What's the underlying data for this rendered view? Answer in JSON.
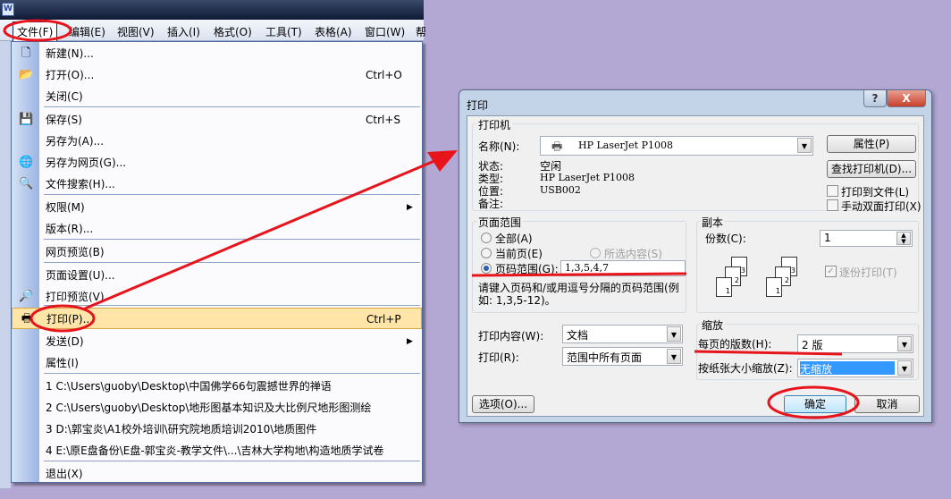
{
  "app": {
    "icon": "word-icon",
    "icon_text": "W"
  },
  "menubar": [
    {
      "label": "文件(F)"
    },
    {
      "label": "编辑(E)"
    },
    {
      "label": "视图(V)"
    },
    {
      "label": "插入(I)"
    },
    {
      "label": "格式(O)"
    },
    {
      "label": "工具(T)"
    },
    {
      "label": "表格(A)"
    },
    {
      "label": "窗口(W)"
    },
    {
      "label": "帮"
    }
  ],
  "file_menu": {
    "items": [
      {
        "label": "新建(N)...",
        "icon": "new-document-icon"
      },
      {
        "label": "打开(O)...",
        "shortcut": "Ctrl+O",
        "icon": "open-folder-icon"
      },
      {
        "label": "关闭(C)"
      },
      {
        "label": "保存(S)",
        "shortcut": "Ctrl+S",
        "icon": "save-icon"
      },
      {
        "label": "另存为(A)..."
      },
      {
        "label": "另存为网页(G)...",
        "icon": "web-page-icon"
      },
      {
        "label": "文件搜索(H)...",
        "icon": "file-search-icon"
      },
      {
        "label": "权限(M)",
        "submenu": true
      },
      {
        "label": "版本(R)..."
      },
      {
        "label": "网页预览(B)"
      },
      {
        "label": "页面设置(U)..."
      },
      {
        "label": "打印预览(V)",
        "icon": "print-preview-icon"
      },
      {
        "label": "打印(P)...",
        "shortcut": "Ctrl+P",
        "icon": "printer-icon",
        "highlighted": true
      },
      {
        "label": "发送(D)",
        "submenu": true
      },
      {
        "label": "属性(I)"
      },
      {
        "label": "1 C:\\Users\\guoby\\Desktop\\中国佛学66句震撼世界的禅语"
      },
      {
        "label": "2 C:\\Users\\guoby\\Desktop\\地形图基本知识及大比例尺地形图测绘"
      },
      {
        "label": "3 D:\\郭宝炎\\A1校外培训\\研究院地质培训2010\\地质图件"
      },
      {
        "label": "4 E:\\原E盘备份\\E盘-郭宝炎-教学文件\\...\\吉林大学构地\\构造地质学试卷"
      },
      {
        "label": "退出(X)"
      }
    ]
  },
  "dialog": {
    "title": "打印",
    "help": "?",
    "close": "X",
    "printer": {
      "group": "打印机",
      "name_label": "名称(N):",
      "name_value": "HP LaserJet P1008",
      "status_label": "状态:",
      "status_value": "空闲",
      "type_label": "类型:",
      "type_value": "HP LaserJet P1008",
      "where_label": "位置:",
      "where_value": "USB002",
      "comment_label": "备注:",
      "properties": "属性(P)",
      "find_printer": "查找打印机(D)...",
      "print_to_file": "打印到文件(L)",
      "manual_duplex": "手动双面打印(X)"
    },
    "range": {
      "group": "页面范围",
      "all": "全部(A)",
      "current": "当前页(E)",
      "selection": "所选内容(S)",
      "pages": "页码范围(G):",
      "pages_value": "1,3,5,4,7",
      "hint": "请键入页码和/或用逗号分隔的页码范围(例如: 1,3,5-12)。",
      "selected": "pages"
    },
    "copies": {
      "group": "副本",
      "count_label": "份数(C):",
      "count_value": "1",
      "collate": "逐份打印(T)",
      "collate_checked": true,
      "collate_disabled": true
    },
    "print_what_label": "打印内容(W):",
    "print_what_value": "文档",
    "print_label": "打印(R):",
    "print_value": "范围中所有页面",
    "zoom": {
      "group": "缩放",
      "pages_per_sheet_label": "每页的版数(H):",
      "pages_per_sheet_value": "2 版",
      "scale_label": "按纸张大小缩放(Z):",
      "scale_value": "无缩放"
    },
    "options": "选项(O)...",
    "ok": "确定",
    "cancel": "取消"
  },
  "annotation_color": "#e8141c"
}
